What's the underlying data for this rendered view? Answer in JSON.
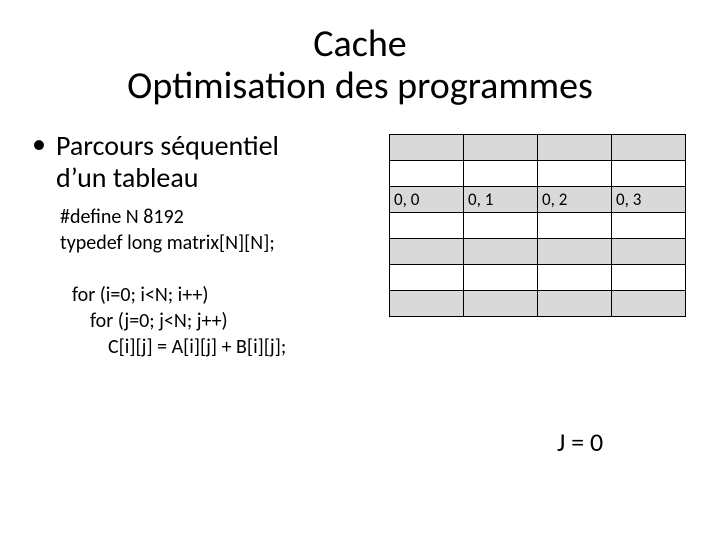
{
  "title_line1": "Cache",
  "title_line2": "Optimisation des programmes",
  "bullet_line1": "Parcours séquentiel",
  "bullet_line2": "d’un tableau",
  "code": {
    "l1": "#define N 8192",
    "l2": "typedef long matrix[N][N];",
    "l3": "for (i=0; i<N; i++)",
    "l4": "for (j=0; j<N; j++)",
    "l5": "C[i][j] = A[i][j] + B[i][j];"
  },
  "grid": {
    "rows": [
      {
        "shaded": true,
        "cells": [
          "",
          "",
          "",
          ""
        ]
      },
      {
        "shaded": false,
        "cells": [
          "",
          "",
          "",
          ""
        ]
      },
      {
        "shaded": true,
        "cells": [
          "0, 0",
          "0, 1",
          "0, 2",
          "0, 3"
        ]
      },
      {
        "shaded": false,
        "cells": [
          "",
          "",
          "",
          ""
        ]
      },
      {
        "shaded": true,
        "cells": [
          "",
          "",
          "",
          ""
        ]
      },
      {
        "shaded": false,
        "cells": [
          "",
          "",
          "",
          ""
        ]
      },
      {
        "shaded": true,
        "cells": [
          "",
          "",
          "",
          ""
        ]
      }
    ]
  },
  "j_label": "J = 0"
}
